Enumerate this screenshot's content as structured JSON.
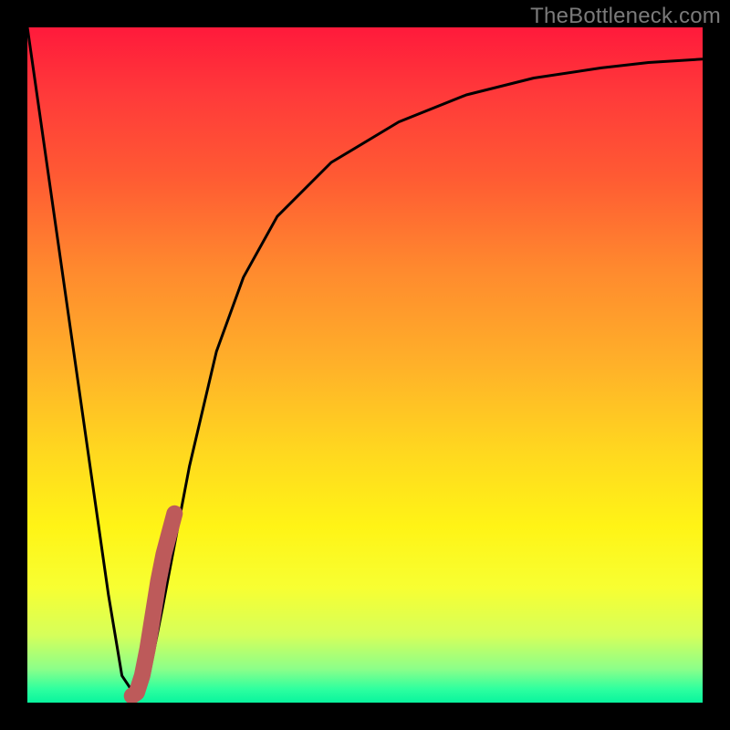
{
  "attribution": "TheBottleneck.com",
  "chart_data": {
    "type": "line",
    "title": "",
    "xlabel": "",
    "ylabel": "",
    "xlim": [
      0,
      100
    ],
    "ylim": [
      0,
      100
    ],
    "series": [
      {
        "name": "bottleneck-curve",
        "color": "#000000",
        "x": [
          0,
          3,
          6,
          9,
          12,
          14,
          16,
          18,
          20,
          24,
          28,
          32,
          37,
          45,
          55,
          65,
          75,
          85,
          92,
          100
        ],
        "y": [
          100,
          79,
          58,
          37,
          16,
          4,
          1,
          4,
          14,
          35,
          52,
          63,
          72,
          80,
          86,
          90,
          92.5,
          94,
          94.8,
          95.3
        ]
      },
      {
        "name": "highlight-segment",
        "color": "#bd5a5a",
        "x": [
          15.5,
          16.2,
          17.0,
          17.8,
          18.6,
          19.4,
          20.2,
          21.0,
          21.8
        ],
        "y": [
          1,
          1.5,
          4,
          8,
          13,
          18,
          22,
          25,
          28
        ]
      }
    ]
  }
}
